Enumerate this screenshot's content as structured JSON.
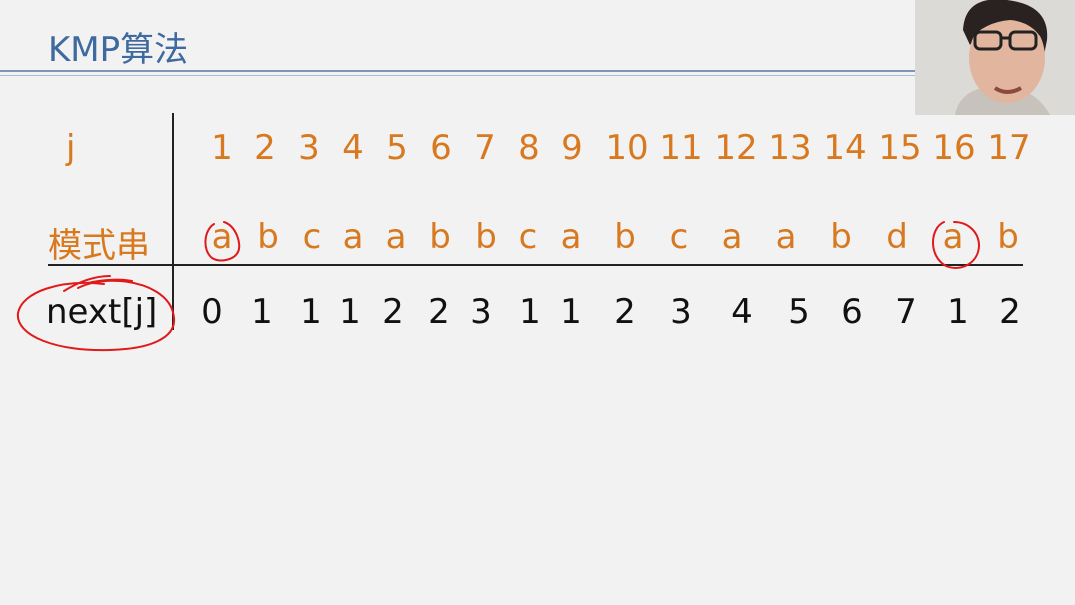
{
  "title": "KMP算法",
  "colors": {
    "title": "#3f6aa0",
    "accent": "#d8791f",
    "ink": "#e0191b"
  },
  "table": {
    "row_labels": {
      "j": "j",
      "pattern": "模式串",
      "next": "next[j]"
    },
    "j": [
      "1",
      "2",
      "3",
      "4",
      "5",
      "6",
      "7",
      "8",
      "9",
      "10",
      "11",
      "12",
      "13",
      "14",
      "15",
      "16",
      "17"
    ],
    "pattern": [
      "a",
      "b",
      "c",
      "a",
      "a",
      "b",
      "b",
      "c",
      "a",
      "b",
      "c",
      "a",
      "a",
      "b",
      "d",
      "a",
      "b"
    ],
    "next": [
      "0",
      "1",
      "1",
      "1",
      "2",
      "2",
      "3",
      "1",
      "1",
      "2",
      "3",
      "4",
      "5",
      "6",
      "7",
      "1",
      "2"
    ]
  },
  "annotations": [
    "circle-around-next-label",
    "circle-around-pattern-1",
    "circle-around-pattern-16"
  ],
  "webcam": {
    "icon": "presenter-video"
  }
}
